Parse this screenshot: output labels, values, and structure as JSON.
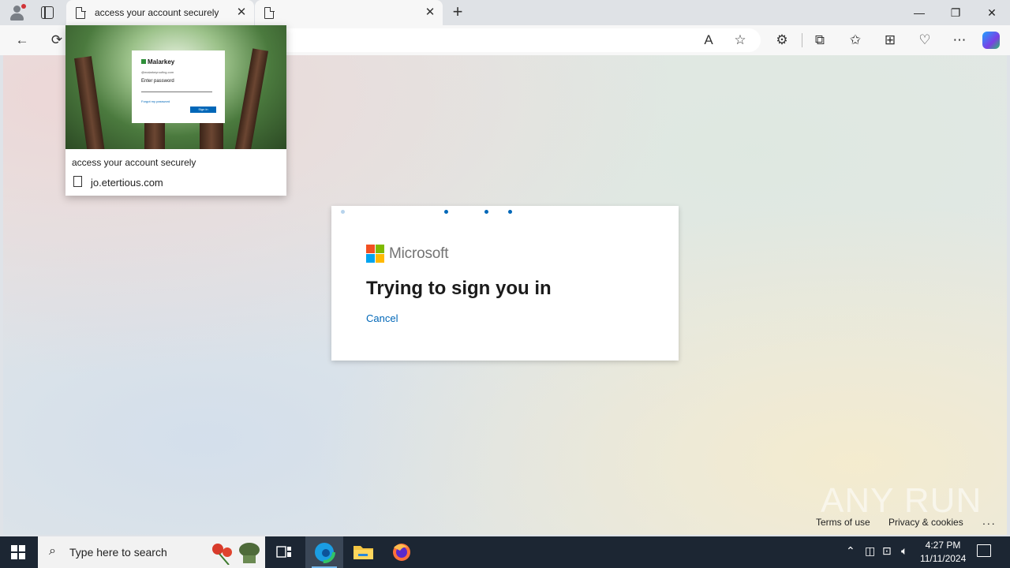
{
  "browser": {
    "tabs": [
      {
        "title": "access your account securely"
      },
      {
        "title": ""
      }
    ],
    "window_controls": {
      "minimize": "—",
      "restore": "❐",
      "close": "✕"
    },
    "new_tab": "+",
    "tab_close": "✕"
  },
  "toolbar": {
    "back": "←",
    "refresh": "⟳",
    "read_aloud": "A",
    "favorite": "☆",
    "extensions": "⚙",
    "split": "⧉",
    "favorites": "✩",
    "collections": "⊞",
    "performance": "♡",
    "more": "⋯"
  },
  "tab_preview": {
    "title": "access your account securely",
    "url": "jo.etertious.com",
    "thumbnail": {
      "brand": "Malarkey",
      "email": "@malarkeyroofing.com",
      "heading": "Enter password",
      "field": "Password",
      "forgot": "Forgot my password",
      "button": "Sign in"
    }
  },
  "signin_card": {
    "brand": "Microsoft",
    "heading": "Trying to sign you in",
    "cancel": "Cancel",
    "logo_colors": [
      "#f25022",
      "#7fba00",
      "#00a4ef",
      "#ffb900"
    ]
  },
  "footer": {
    "terms": "Terms of use",
    "privacy": "Privacy & cookies",
    "more": "..."
  },
  "watermark": "ANY RUN",
  "taskbar": {
    "search_placeholder": "Type here to search",
    "time": "4:27 PM",
    "date": "11/11/2024"
  }
}
